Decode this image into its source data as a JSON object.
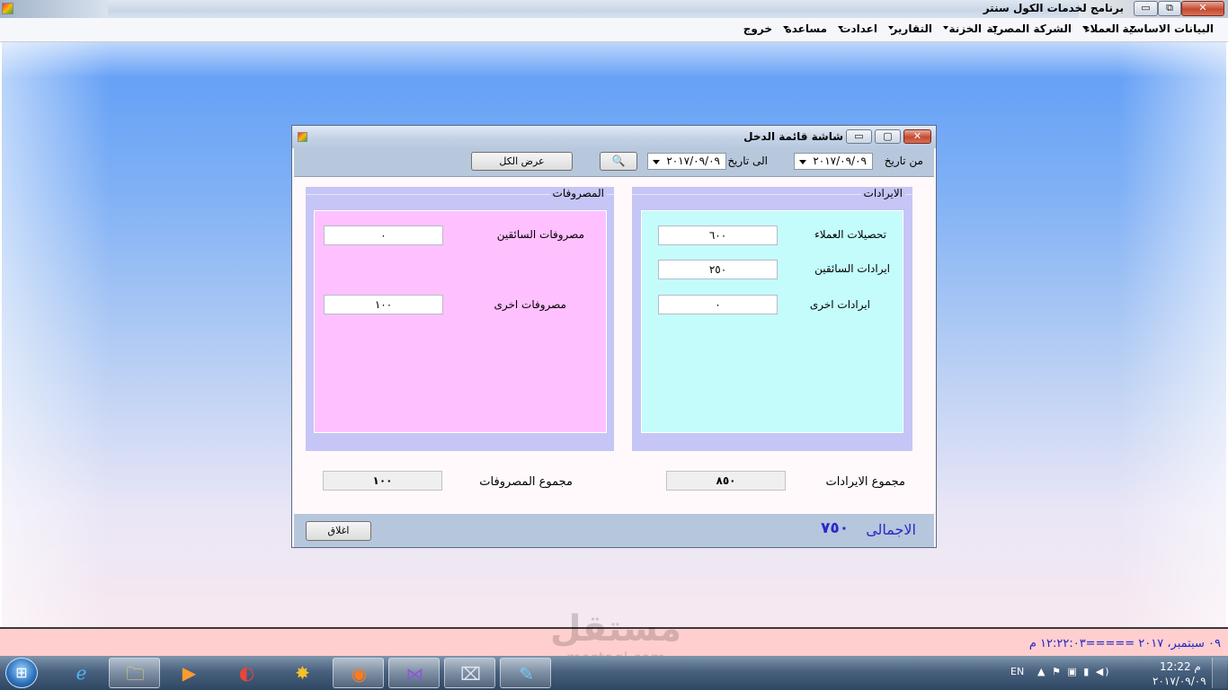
{
  "main_window": {
    "title": "برنامج لخدمات الكول سنتر",
    "minimize_glyph": "▭",
    "maximize_glyph": "⧉",
    "close_glyph": "✕"
  },
  "menu": [
    {
      "label": "البيانات الاساسية"
    },
    {
      "label": "العملاء"
    },
    {
      "label": "الشركة المصرية"
    },
    {
      "label": "الخزنة"
    },
    {
      "label": "التقارير"
    },
    {
      "label": "اعدادت"
    },
    {
      "label": "مساعدة"
    },
    {
      "label": "خروج"
    }
  ],
  "dialog": {
    "title": "شاشة قائمة الدخل",
    "minimize_glyph": "▭",
    "maximize_glyph": "▢",
    "close_glyph": "✕",
    "toolbar": {
      "from_label": "من تاريخ",
      "from_date": "٢٠١٧/٠٩/٠٩",
      "to_label": "الى تاريخ",
      "to_date": "٢٠١٧/٠٩/٠٩",
      "search_glyph": "🔍",
      "show_all_label": "عرض الكل"
    },
    "revenues": {
      "title": "الايرادات",
      "fields": [
        {
          "label": "تحصيلات العملاء",
          "value": "٦٠٠"
        },
        {
          "label": "ايرادات السائقين",
          "value": "٢٥٠"
        },
        {
          "label": "ايرادات اخرى",
          "value": "٠"
        }
      ],
      "total_label": "مجموع الايرادات",
      "total_value": "٨٥٠"
    },
    "expenses": {
      "title": "المصروفات",
      "fields": [
        {
          "label": "مصروفات السائقين",
          "value": "٠"
        },
        {
          "label": "مصروفات اخرى",
          "value": "١٠٠"
        }
      ],
      "total_label": "مجموع المصروفات",
      "total_value": "١٠٠"
    },
    "net": {
      "label": "الاجمالى",
      "value": "٧٥٠"
    },
    "close_label": "اغلاق"
  },
  "status_line": "٠٩ سبتمبر، ٢٠١٧  =====١٢:٢٢:٠٣ م",
  "taskbar": {
    "start_glyph": "⊞",
    "apps": [
      {
        "icon": "internet-explorer-icon",
        "glyph": "ℯ"
      },
      {
        "icon": "file-explorer-icon",
        "glyph": "🗀"
      },
      {
        "icon": "media-player-icon",
        "glyph": "▶"
      },
      {
        "icon": "browser-icon",
        "glyph": "◐"
      },
      {
        "icon": "colorful-app-icon",
        "glyph": "✸"
      },
      {
        "icon": "firefox-icon",
        "glyph": "◉"
      },
      {
        "icon": "visual-studio-icon",
        "glyph": "⋈"
      },
      {
        "icon": "cash-register-icon",
        "glyph": "⌧"
      },
      {
        "icon": "paint-icon",
        "glyph": "✎"
      }
    ],
    "language": "EN",
    "tray_glyphs": "▲ ⚑ ▣ ▮ ◀)",
    "time": "12:22 م",
    "date": "٢٠١٧/٠٩/٠٩"
  },
  "watermark": {
    "big": "مستقل",
    "small": "mostaql.com"
  }
}
